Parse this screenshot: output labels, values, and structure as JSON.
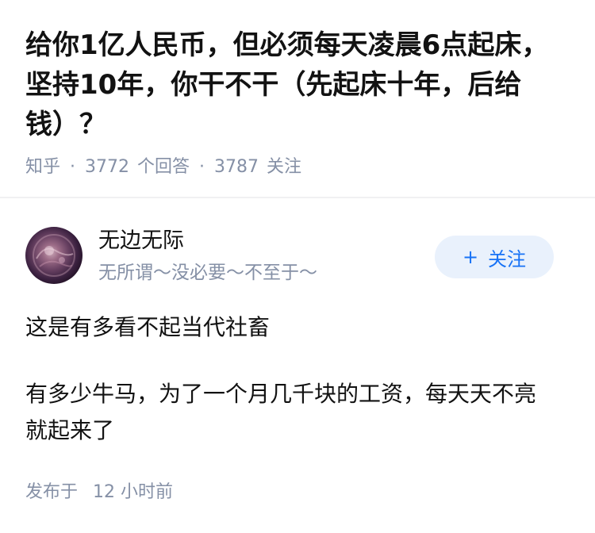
{
  "question": {
    "title": "给你1亿人民币，但必须每天凌晨6点起床，坚持10年，你干不干（先起床十年，后给钱）？",
    "source": "知乎",
    "answer_count": "3772",
    "answer_label": "个回答",
    "follow_count": "3787",
    "follow_label": "关注"
  },
  "author": {
    "name": "无边无际",
    "bio": "无所谓～没必要～不至于～",
    "follow_button": "关注"
  },
  "answer": {
    "paragraphs": [
      "这是有多看不起当代社畜",
      "有多少牛马，为了一个月几千块的工资，每天天不亮就起来了"
    ],
    "published_label": "发布于",
    "published_time": "12 小时前"
  },
  "colors": {
    "text_primary": "#121212",
    "text_secondary": "#8590a6",
    "accent": "#1772f6",
    "accent_bg": "#e9f1fc"
  }
}
